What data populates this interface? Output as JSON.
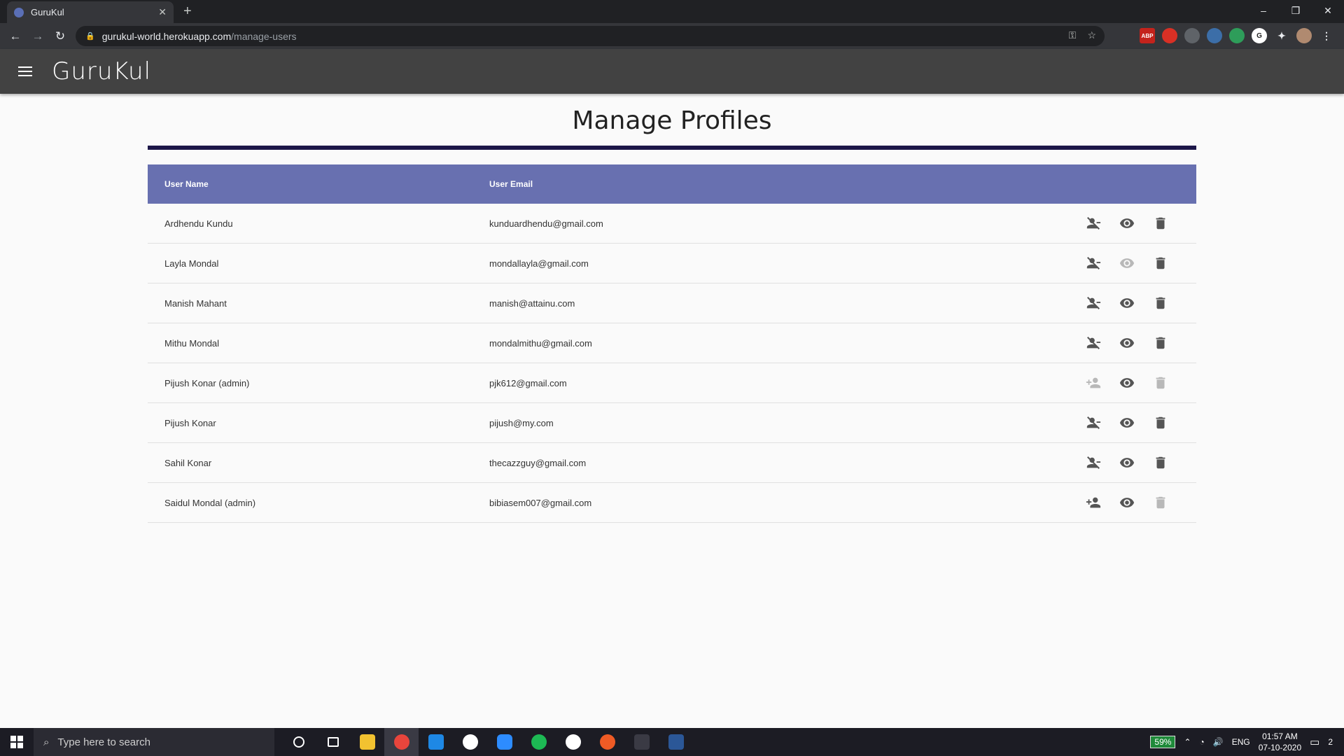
{
  "browser": {
    "tab_title": "GuruKul",
    "url_host": "gurukul-world.herokuapp.com",
    "url_path": "/manage-users"
  },
  "app": {
    "brand": "GuruKul"
  },
  "page": {
    "title": "Manage Profiles"
  },
  "table": {
    "headers": [
      "User Name",
      "User Email"
    ],
    "rows": [
      {
        "name": "Ardhendu Kundu",
        "email": "kunduardhendu@gmail.com"
      },
      {
        "name": "Layla Mondal",
        "email": "mondallayla@gmail.com"
      },
      {
        "name": "Manish Mahant",
        "email": "manish@attainu.com"
      },
      {
        "name": "Mithu Mondal",
        "email": "mondalmithu@gmail.com"
      },
      {
        "name": "Pijush Konar (admin)",
        "email": "pjk612@gmail.com"
      },
      {
        "name": "Pijush Konar",
        "email": "pijush@my.com"
      },
      {
        "name": "Sahil Konar",
        "email": "thecazzguy@gmail.com"
      },
      {
        "name": "Saidul Mondal (admin)",
        "email": "bibiasem007@gmail.com"
      }
    ]
  },
  "taskbar": {
    "search_placeholder": "Type here to search",
    "battery": "59%",
    "language": "ENG",
    "time": "01:57 AM",
    "date": "07-10-2020",
    "notifications": "2"
  }
}
